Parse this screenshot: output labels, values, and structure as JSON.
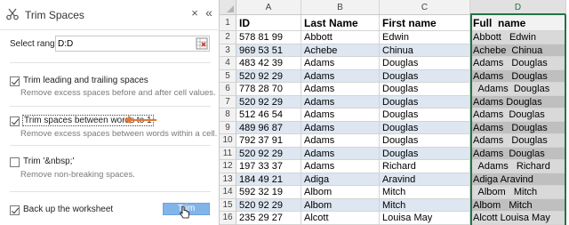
{
  "pane": {
    "title": "Trim Spaces",
    "close_icon": "×",
    "collapse_icon": "«",
    "select_range_label": "Select range:",
    "select_range_value": "D:D",
    "options": [
      {
        "label": "Trim leading and trailing spaces",
        "description": "Remove excess spaces before and after cell values.",
        "checked": true
      },
      {
        "label": "Trim spaces between words to 1",
        "description": "Remove excess spaces between words within a cell.",
        "checked": true
      },
      {
        "label": "Trim '&nbsp;'",
        "description": "Remove non-breaking spaces.",
        "checked": false
      }
    ],
    "backup_label": "Back up the worksheet",
    "backup_checked": true,
    "trim_button": "Trim",
    "accent_color": "#e8792b"
  },
  "sheet": {
    "columns": [
      "A",
      "B",
      "C",
      "D"
    ],
    "active_column": "D",
    "header_row": {
      "row": "1",
      "cells": [
        "ID",
        "Last Name",
        "First name",
        "Full  name"
      ]
    },
    "rows": [
      {
        "row": "2",
        "cells": [
          "578 81 99",
          "Abbott",
          "Edwin",
          "Abbott   Edwin"
        ]
      },
      {
        "row": "3",
        "cells": [
          "969 53 51",
          "Achebe",
          "Chinua",
          "Achebe  Chinua"
        ]
      },
      {
        "row": "4",
        "cells": [
          "483 42 39",
          "Adams",
          "Douglas",
          "Adams   Douglas"
        ]
      },
      {
        "row": "5",
        "cells": [
          "520 92 29",
          "Adams",
          "Douglas",
          "Adams   Douglas"
        ]
      },
      {
        "row": "6",
        "cells": [
          "778 28 70",
          "Adams",
          "Douglas",
          "  Adams  Douglas"
        ]
      },
      {
        "row": "7",
        "cells": [
          "520 92 29",
          "Adams",
          "Douglas",
          "Adams Douglas"
        ]
      },
      {
        "row": "8",
        "cells": [
          "512 46 54",
          "Adams",
          "Douglas",
          "Adams  Douglas"
        ]
      },
      {
        "row": "9",
        "cells": [
          "489 96 87",
          "Adams",
          "Douglas",
          "Adams   Douglas"
        ]
      },
      {
        "row": "10",
        "cells": [
          "792 37 91",
          "Adams",
          "Douglas",
          "Adams   Douglas"
        ]
      },
      {
        "row": "11",
        "cells": [
          "520 92 29",
          "Adams",
          "Douglas",
          "Adams  Douglas"
        ]
      },
      {
        "row": "12",
        "cells": [
          "197 33 37",
          "Adams",
          "Richard",
          "  Adams   Richard"
        ]
      },
      {
        "row": "13",
        "cells": [
          "184 49 21",
          "Adiga",
          "Aravind",
          "Adiga Aravind"
        ]
      },
      {
        "row": "14",
        "cells": [
          "592 32 19",
          "Albom",
          "Mitch",
          "  Albom   Mitch"
        ]
      },
      {
        "row": "15",
        "cells": [
          "520 92 29",
          "Albom",
          "Mitch",
          "Albom   Mitch"
        ]
      },
      {
        "row": "16",
        "cells": [
          "235 29 27",
          "Alcott",
          "Louisa May",
          "Alcott Louisa May"
        ]
      }
    ],
    "grid_color": "#217346",
    "band_color": "#dde6f1"
  }
}
